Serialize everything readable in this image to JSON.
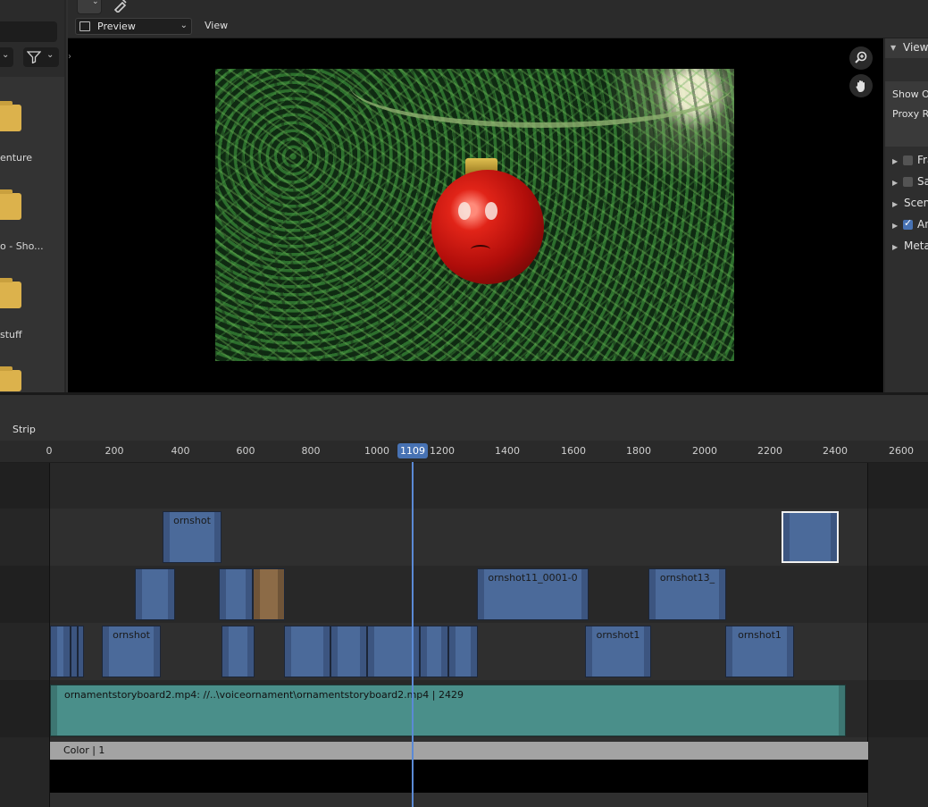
{
  "header": {
    "view_mode": "Preview",
    "view_menu": "View"
  },
  "file_browser": {
    "items": [
      {
        "name": "enture"
      },
      {
        "name": "o - Sho..."
      },
      {
        "name": "stuff"
      },
      {
        "name": ""
      }
    ]
  },
  "sidebar": {
    "panel_title": "View",
    "rows": [
      "Show Ov",
      "Proxy Re"
    ],
    "subpanels": [
      {
        "label": "Fra",
        "checkbox": false
      },
      {
        "label": "Sa",
        "checkbox": false
      },
      {
        "label": "Scen",
        "checkbox": null
      },
      {
        "label": "An",
        "checkbox": true
      },
      {
        "label": "Meta",
        "checkbox": null
      }
    ]
  },
  "sequencer": {
    "menu": "Strip",
    "ruler_ticks": [
      "0",
      "200",
      "400",
      "600",
      "800",
      "1000",
      "1200",
      "1400",
      "1600",
      "1800",
      "2000",
      "2200",
      "2400",
      "2600"
    ],
    "current_frame": "1109",
    "strips": {
      "s1": "ornshot",
      "s2": "ornshot11_0001-0",
      "s3": "ornshot13_",
      "s4": "ornshot",
      "s5": "ornshot1",
      "s6": "ornshot1",
      "sound": "ornamentstoryboard2.mp4: //..\\voiceornament\\ornamentstoryboard2.mp4 | 2429",
      "color": "Color | 1"
    }
  },
  "colors": {
    "accent": "#4772b3",
    "movie_strip": "#4b6a9a",
    "sound_strip": "#4a8f8a",
    "image_strip": "#8c6b47"
  }
}
